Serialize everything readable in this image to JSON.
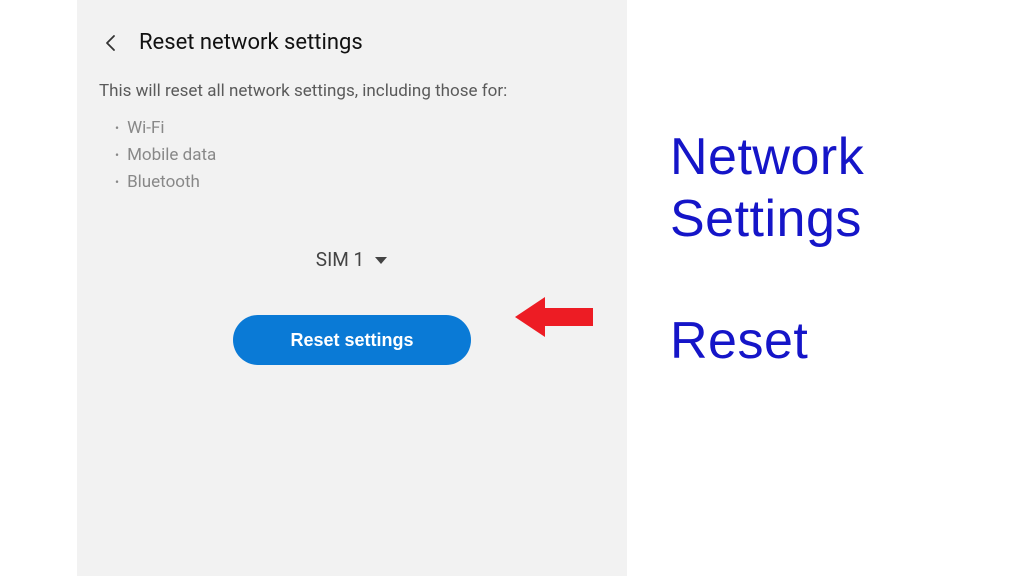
{
  "header": {
    "title": "Reset network settings"
  },
  "body": {
    "description": "This will reset all network settings, including those for:",
    "bullets": [
      "Wi-Fi",
      "Mobile data",
      "Bluetooth"
    ]
  },
  "sim": {
    "label": "SIM 1"
  },
  "action": {
    "reset_label": "Reset settings"
  },
  "annotation": {
    "caption_line1": "Network Settings",
    "caption_line2": "Reset"
  },
  "colors": {
    "button_bg": "#0a7ad6",
    "arrow": "#ed1c24",
    "caption": "#1515c8"
  }
}
